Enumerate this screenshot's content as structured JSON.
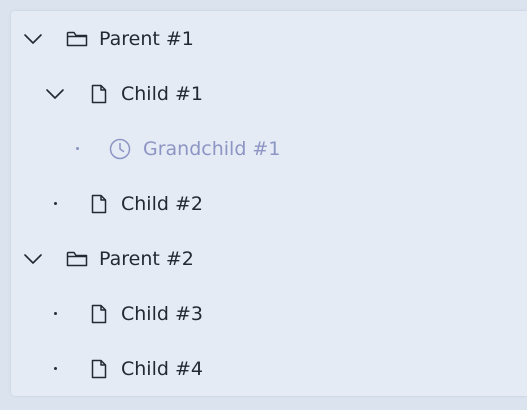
{
  "tree": {
    "colors": {
      "text": "#232833",
      "muted": "#8c95c4",
      "panel": "#e5ebf4",
      "background": "#dbe3ee"
    },
    "nodes": [
      {
        "label": "Parent #1",
        "icon": "folder-icon",
        "expanded": true
      },
      {
        "label": "Child #1",
        "icon": "file-icon",
        "expanded": true
      },
      {
        "label": "Grandchild #1",
        "icon": "clock-icon",
        "disabled": true
      },
      {
        "label": "Child #2",
        "icon": "file-icon"
      },
      {
        "label": "Parent #2",
        "icon": "folder-icon",
        "expanded": true
      },
      {
        "label": "Child #3",
        "icon": "file-icon"
      },
      {
        "label": "Child #4",
        "icon": "file-icon"
      }
    ]
  }
}
